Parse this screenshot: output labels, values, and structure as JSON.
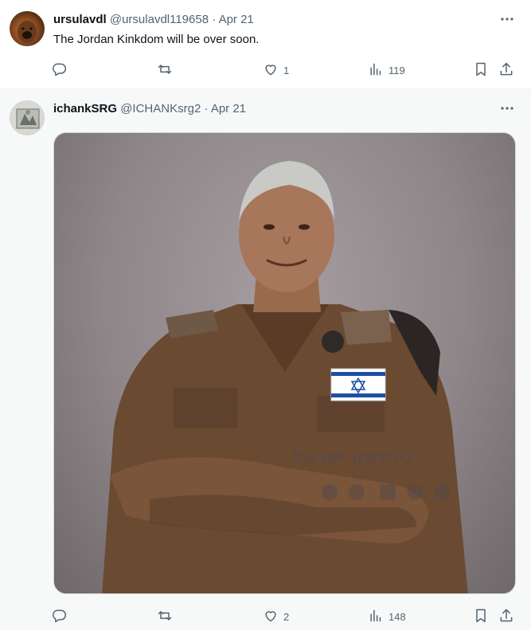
{
  "tweets": [
    {
      "name": "ursulavdl",
      "handle": "@ursulavdl119658",
      "separator": "·",
      "date": "Apr 21",
      "text": "The Jordan Kinkdom will be over soon.",
      "replies": "",
      "retweets": "",
      "likes": "1",
      "views": "119"
    },
    {
      "name": "ichankSRG",
      "handle": "@ICHANKsrg2",
      "separator": "·",
      "date": "Apr 21",
      "media": {
        "watermark": "ניוזדסק ישראל",
        "flag_colors": {
          "blue": "#1f4fa3",
          "white": "#ffffff"
        },
        "uniform_color": "#6b4a32"
      },
      "replies": "",
      "retweets": "",
      "likes": "2",
      "views": "148"
    }
  ],
  "colors": {
    "text": "#0f1419",
    "muted": "#536471",
    "border": "#eff3f4"
  },
  "icons": [
    "more-icon",
    "reply-icon",
    "retweet-icon",
    "like-icon",
    "views-icon",
    "bookmark-icon",
    "share-icon"
  ]
}
